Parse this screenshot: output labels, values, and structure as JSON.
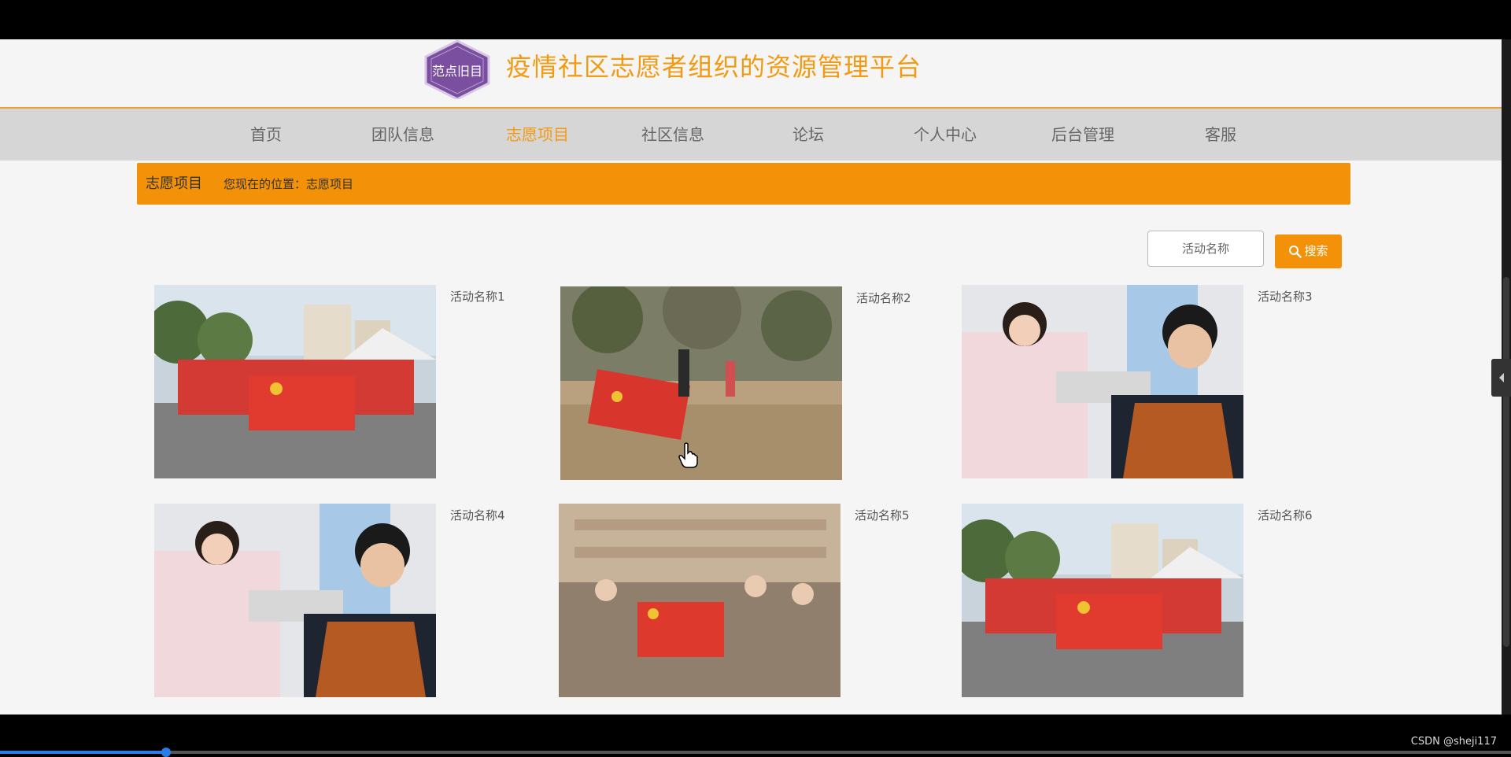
{
  "site": {
    "title": "疫情社区志愿者组织的资源管理平台",
    "logo_text": "范点旧目"
  },
  "nav": {
    "items": [
      {
        "label": "首页"
      },
      {
        "label": "团队信息"
      },
      {
        "label": "志愿项目",
        "active": true
      },
      {
        "label": "社区信息"
      },
      {
        "label": "论坛"
      },
      {
        "label": "个人中心"
      },
      {
        "label": "后台管理"
      },
      {
        "label": "客服"
      }
    ]
  },
  "breadcrumb": {
    "title": "志愿项目",
    "path": "您现在的位置：志愿项目"
  },
  "search": {
    "placeholder": "活动名称",
    "button_label": "搜索",
    "icon": "search-icon"
  },
  "projects": [
    {
      "name": "活动名称1",
      "photo": "volunteer-group-banner"
    },
    {
      "name": "活动名称2",
      "photo": "tree-planting-field"
    },
    {
      "name": "活动名称3",
      "photo": "blood-donation"
    },
    {
      "name": "活动名称4",
      "photo": "blood-donation"
    },
    {
      "name": "活动名称5",
      "photo": "community-group-banner"
    },
    {
      "name": "活动名称6",
      "photo": "volunteer-group-banner"
    }
  ],
  "video": {
    "progress": 0.11
  },
  "watermark": "CSDN @sheji117",
  "colors": {
    "accent": "#f39208",
    "title": "#f29a12",
    "nav_bg": "#d6d6d6",
    "page_bg": "#f5f5f5"
  }
}
